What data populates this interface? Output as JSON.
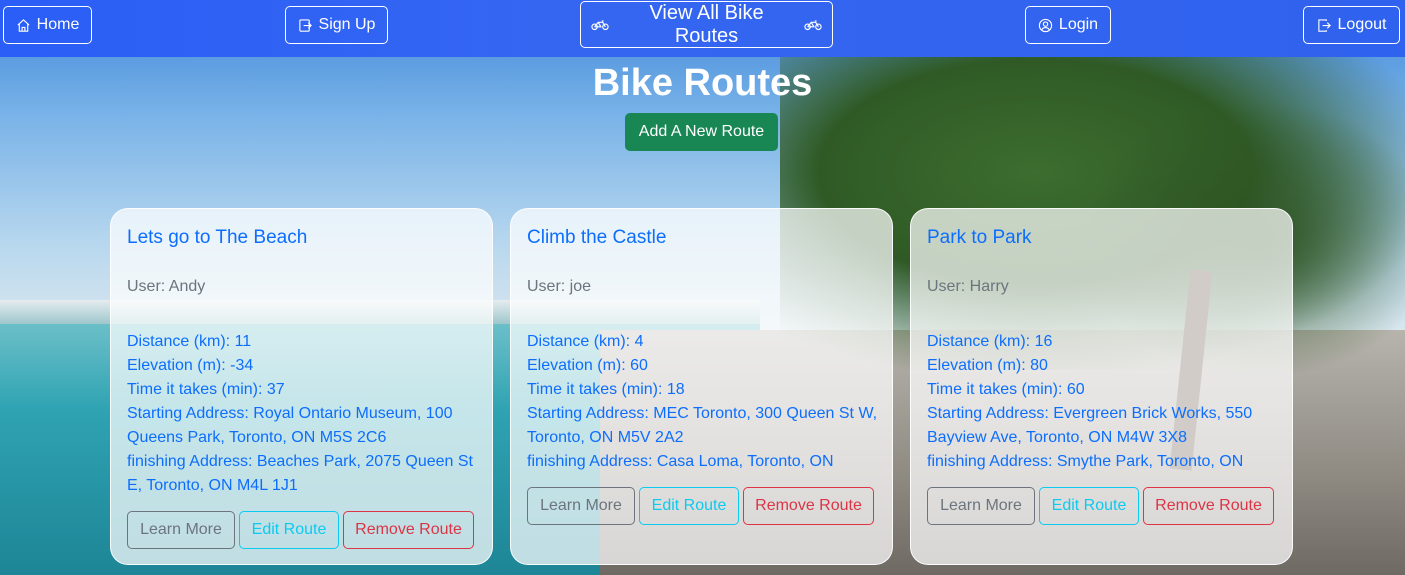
{
  "nav": {
    "home": "Home",
    "signup": "Sign Up",
    "view_all": "View All Bike Routes",
    "login": "Login",
    "logout": "Logout"
  },
  "page": {
    "title": "Bike Routes",
    "add_button": "Add A New Route"
  },
  "routes": [
    {
      "title": "Lets go to The Beach",
      "user": "User: Andy",
      "distance": "Distance (km): 11",
      "elevation": "Elevation (m): -34",
      "time": "Time it takes (min): 37",
      "start": "Starting Address: Royal Ontario Museum, 100 Queens Park, Toronto, ON M5S 2C6",
      "finish": "finishing Address: Beaches Park, 2075 Queen St E, Toronto, ON M4L 1J1",
      "learn": "Learn More",
      "edit": "Edit Route",
      "remove": "Remove Route"
    },
    {
      "title": "Climb the Castle",
      "user": "User: joe",
      "distance": "Distance (km): 4",
      "elevation": "Elevation (m): 60",
      "time": "Time it takes (min): 18",
      "start": "Starting Address: MEC Toronto, 300 Queen St W, Toronto, ON M5V 2A2",
      "finish": "finishing Address: Casa Loma, Toronto, ON",
      "learn": "Learn More",
      "edit": "Edit Route",
      "remove": "Remove Route"
    },
    {
      "title": "Park to Park",
      "user": "User: Harry",
      "distance": "Distance (km): 16",
      "elevation": "Elevation (m): 80",
      "time": "Time it takes (min): 60",
      "start": "Starting Address: Evergreen Brick Works, 550 Bayview Ave, Toronto, ON M4W 3X8",
      "finish": "finishing Address: Smythe Park, Toronto, ON",
      "learn": "Learn More",
      "edit": "Edit Route",
      "remove": "Remove Route"
    }
  ],
  "colors": {
    "primary": "#0d6efd",
    "success": "#198754",
    "secondary": "#6c757d",
    "info": "#0dcaf0",
    "danger": "#dc3545",
    "navbar": "#2f62ee"
  },
  "icons": {
    "home": "house-icon",
    "signup": "signup-icon",
    "bike": "bicycle-icon",
    "login": "user-circle-icon",
    "logout": "logout-icon"
  }
}
